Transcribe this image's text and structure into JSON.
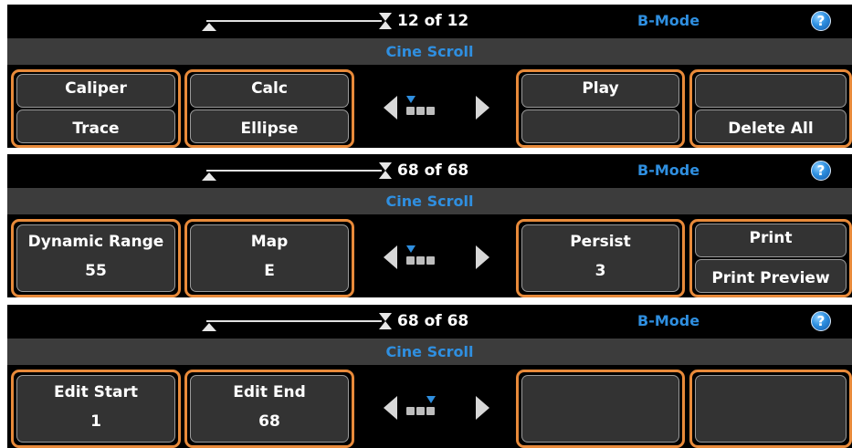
{
  "panels": [
    {
      "frame_counter": "12 of 12",
      "mode": "B-Mode",
      "help_icon": "?",
      "cine_scroll": "Cine Scroll",
      "groups": [
        {
          "top": "Caliper",
          "bottom": "Trace"
        },
        {
          "top": "Calc",
          "bottom": "Ellipse"
        },
        {
          "top": "Play",
          "bottom": ""
        },
        {
          "top": "",
          "bottom": "Delete All"
        }
      ],
      "page_indicator": {
        "current": 1,
        "total": 3
      }
    },
    {
      "frame_counter": "68 of 68",
      "mode": "B-Mode",
      "help_icon": "?",
      "cine_scroll": "Cine Scroll",
      "groups": [
        {
          "label": "Dynamic Range",
          "value": "55"
        },
        {
          "label": "Map",
          "value": "E"
        },
        {
          "label": "Persist",
          "value": "3"
        },
        {
          "top": "Print",
          "bottom": "Print Preview"
        }
      ],
      "page_indicator": {
        "current": 1,
        "total": 3
      }
    },
    {
      "frame_counter": "68 of 68",
      "mode": "B-Mode",
      "help_icon": "?",
      "cine_scroll": "Cine Scroll",
      "groups": [
        {
          "label": "Edit Start",
          "value": "1"
        },
        {
          "label": "Edit End",
          "value": "68"
        },
        {
          "label": "",
          "value": ""
        },
        {
          "label": "",
          "value": ""
        }
      ],
      "page_indicator": {
        "current": 3,
        "total": 3
      }
    }
  ],
  "colors": {
    "accent_orange": "#e88a3a",
    "mode_blue": "#2f8fe0",
    "button_gray": "#333333"
  }
}
